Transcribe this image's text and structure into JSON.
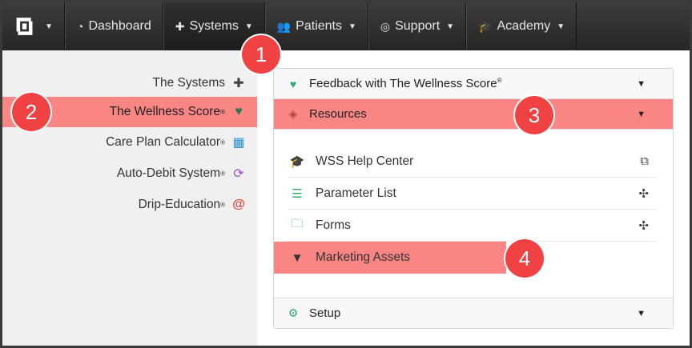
{
  "navbar": {
    "items": [
      {
        "label": "Dashboard",
        "icon": "dashboard-icon"
      },
      {
        "label": "Systems",
        "icon": "puzzle-icon"
      },
      {
        "label": "Patients",
        "icon": "users-icon"
      },
      {
        "label": "Support",
        "icon": "lifebuoy-icon"
      },
      {
        "label": "Academy",
        "icon": "graduation-cap-icon"
      }
    ]
  },
  "sidebar": {
    "items": [
      {
        "label": "The Systems",
        "reg": "",
        "icon": "puzzle-icon"
      },
      {
        "label": "The Wellness Score",
        "reg": "®",
        "icon": "heart-pulse-icon"
      },
      {
        "label": "Care Plan Calculator",
        "reg": "®",
        "icon": "calculator-icon"
      },
      {
        "label": "Auto-Debit System",
        "reg": "®",
        "icon": "refresh-icon"
      },
      {
        "label": "Drip-Education",
        "reg": "®",
        "icon": "at-icon"
      }
    ]
  },
  "panel": {
    "sections": [
      {
        "label": "Feedback with The Wellness Score",
        "reg": "®",
        "icon": "heart-pulse-icon"
      },
      {
        "label": "Resources",
        "reg": "",
        "icon": "diamond-icon"
      },
      {
        "label": "Setup",
        "reg": "",
        "icon": "cogs-icon"
      }
    ],
    "resources": [
      {
        "label": "WSS Help Center",
        "icon": "graduation-cap-icon",
        "end_icon": "external-link-icon"
      },
      {
        "label": "Parameter List",
        "icon": "list-icon",
        "end_icon": "pinwheel-icon"
      },
      {
        "label": "Forms",
        "icon": "folder-open-icon",
        "end_icon": "pinwheel-icon"
      },
      {
        "label": "Marketing Assets",
        "icon": "filter-icon",
        "end_icon": ""
      }
    ]
  },
  "markers": [
    "1",
    "2",
    "3",
    "4"
  ],
  "colors": {
    "highlight": "#f98585",
    "marker": "#f04242",
    "accent_green": "#2fa86a",
    "navbar": "#2e2e2e"
  }
}
